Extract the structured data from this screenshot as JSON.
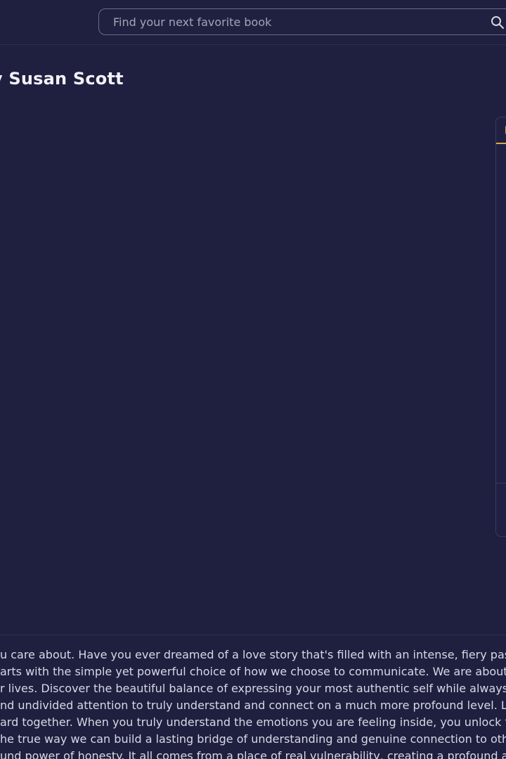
{
  "header": {
    "search": {
      "placeholder": "Find your next favorite book"
    }
  },
  "book": {
    "title": "y Susan Scott"
  },
  "description": {
    "lines": [
      "u care about. Have you ever dreamed of a love story that's filled with an intense, fiery passion, y",
      "arts with the simple yet powerful choice of how we choose to communicate. We are about to un",
      "r lives. Discover the beautiful balance of expressing your most authentic self while always leadi",
      "nd undivided attention to truly understand and connect on a much more profound level. Learn h",
      "ard together. When you truly understand the emotions you are feeling inside, you unlock the pot",
      "he true way we can build a lasting bridge of understanding and genuine connection to others. Le",
      "und power of honesty. It all comes from a place of real vulnerability, creating a profound and las"
    ]
  },
  "colors": {
    "background": "#1f1f3f",
    "accent": "#e0a64a"
  }
}
